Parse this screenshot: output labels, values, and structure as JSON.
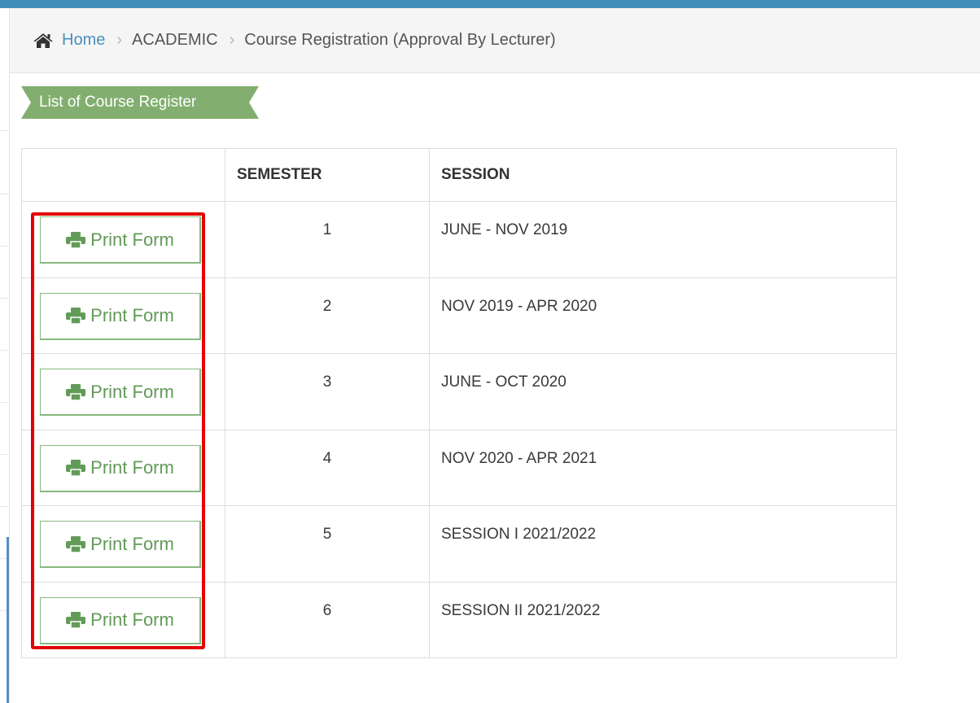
{
  "breadcrumb": {
    "home": "Home",
    "section": "ACADEMIC",
    "current": "Course Registration (Approval By Lecturer)",
    "separator": "›"
  },
  "panel": {
    "title": "List of Course Register",
    "ribbon_color": "#82af6f"
  },
  "table": {
    "headers": [
      "",
      "SEMESTER",
      "SESSION"
    ],
    "rows": [
      {
        "action": "Print Form",
        "semester": "1",
        "session": "JUNE - NOV 2019"
      },
      {
        "action": "Print Form",
        "semester": "2",
        "session": "NOV 2019 - APR 2020"
      },
      {
        "action": "Print Form",
        "semester": "3",
        "session": "JUNE - OCT 2020"
      },
      {
        "action": "Print Form",
        "semester": "4",
        "session": "NOV 2020 - APR 2021"
      },
      {
        "action": "Print Form",
        "semester": "5",
        "session": "SESSION I 2021/2022"
      },
      {
        "action": "Print Form",
        "semester": "6",
        "session": "SESSION II 2021/2022"
      }
    ]
  },
  "icons": {
    "home": "home-icon",
    "print": "printer-icon"
  },
  "colors": {
    "top_bar": "#438eb9",
    "link": "#4c8fbd",
    "button_text": "#629b58",
    "button_border": "#87b87f",
    "highlight": "#e30000"
  }
}
